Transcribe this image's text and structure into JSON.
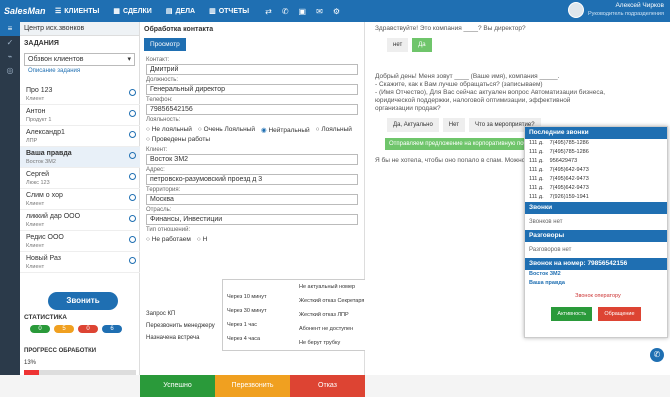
{
  "topbar": {
    "logo": "SalesMan",
    "nav": [
      "КЛИЕНТЫ",
      "СДЕЛКИ",
      "ДЕЛА",
      "ОТЧЕТЫ"
    ],
    "user_name": "Алексей Чирков",
    "user_role": "Руководитель подразделения"
  },
  "panel1": {
    "title": "Центр исх.звонков",
    "tasks_label": "ЗАДАНИЯ",
    "select": "Обзвон клиентов",
    "link": "Описание задания",
    "items": [
      {
        "name": "Про 123",
        "sub": "Клиент"
      },
      {
        "name": "Антон",
        "sub": "Продукт 1"
      },
      {
        "name": "Александр1",
        "sub": "ЛПР"
      },
      {
        "name": "Ваша правда",
        "sub": "Восток ЗМ2"
      },
      {
        "name": "Сергей",
        "sub": "Люкс 123"
      },
      {
        "name": "Слим о хор",
        "sub": "Клиент"
      },
      {
        "name": "ликкий дар ООО",
        "sub": "Клиент"
      },
      {
        "name": "Редис ООО",
        "sub": "Клиент"
      },
      {
        "name": "Новый Раз",
        "sub": "Клиент"
      }
    ],
    "call_button": "Звонить",
    "stats_label": "СТАТИСТИКА",
    "stats": [
      "0",
      "5",
      "0",
      "6"
    ],
    "progress_label": "ПРОГРЕСС ОБРАБОТКИ",
    "progress": "13%"
  },
  "panel2": {
    "title": "Обработка контакта",
    "view_button": "Просмотр",
    "contact_label": "Контакт:",
    "contact": "Дмитрий",
    "position_label": "Должность:",
    "position": "Генеральный директор",
    "phone_label": "Телефон:",
    "phone": "79856542156",
    "loyalty_label": "Лояльность:",
    "loyalty": [
      "Не лояльный",
      "Очень Лояльный",
      "Нейтральный",
      "Лояльный",
      "Проведены работы"
    ],
    "client_label": "Клиент:",
    "client": "Восток ЗМ2",
    "address_label": "Адрес:",
    "address": "петровско-разумовский проезд д 3",
    "territory_label": "Территория:",
    "territory": "Москва",
    "industry_label": "Отрасль:",
    "industry": "Финансы, Инвестиции",
    "relation_label": "Тип отношений:",
    "relation": [
      "Не работаем",
      "Н"
    ],
    "menu": [
      "Запрос КП",
      "Перезвонить менеджеру",
      "Назначена встреча"
    ],
    "popup_col1": [
      "Через 10 минут",
      "Через 30 минут",
      "Через 1 час",
      "Через 4 часа"
    ],
    "popup_col2": [
      "Не актуальный номер",
      "Жесткий отказ Секретаря",
      "Жесткий отказ ЛПР",
      "Абонент не доступен",
      "Не берут трубку"
    ],
    "footer": [
      "Успешно",
      "Перезвонить",
      "Отказ"
    ],
    "view_small": "Просмотр"
  },
  "panel3": {
    "q1": "Здравствуйте! Это компания ____? Вы директор?",
    "btn_no": "нет",
    "btn_yes": "Да",
    "q2": "Добрый день! Меня зовут ____ (Ваше имя), компания _____.\n- Скажите, как к Вам лучше обращаться? (записываем)\n- (Имя Отчество), Для Вас сейчас актуален вопрос Автоматизации бизнеса, юридической поддержки, налоговой оптимизации, эффективной организации продаж?",
    "btns": [
      "Да, Актуально",
      "Нет",
      "Что за мероприятие?"
    ],
    "green": "Отправляем предложение на корпоративную почту",
    "q3": "Я бы не хотела, чтобы оно попало в спам. Можно записать"
  },
  "recent": {
    "title": "Последние звонки",
    "rows": [
      [
        "111 д.",
        "7(495)785-1286"
      ],
      [
        "111 д.",
        "7(495)785-1286"
      ],
      [
        "111 д.",
        "956429473"
      ],
      [
        "111 д.",
        "7(495)642-9473"
      ],
      [
        "111 д.",
        "7(495)642-9473"
      ],
      [
        "111 д.",
        "7(495)642-9473"
      ],
      [
        "111 д.",
        "7(926)159-1941"
      ]
    ],
    "calls_label": "Звонки",
    "calls_none": "Звонков нет",
    "talks_label": "Разговоры",
    "talks_none": "Разговоров нет",
    "number_label": "Звонок на номер:",
    "number": "79856542156",
    "client": "Восток ЗМ2",
    "truth": "Ваша правда",
    "operator": "Звонок оператору",
    "active": "Активность",
    "callback": "Обращение"
  }
}
